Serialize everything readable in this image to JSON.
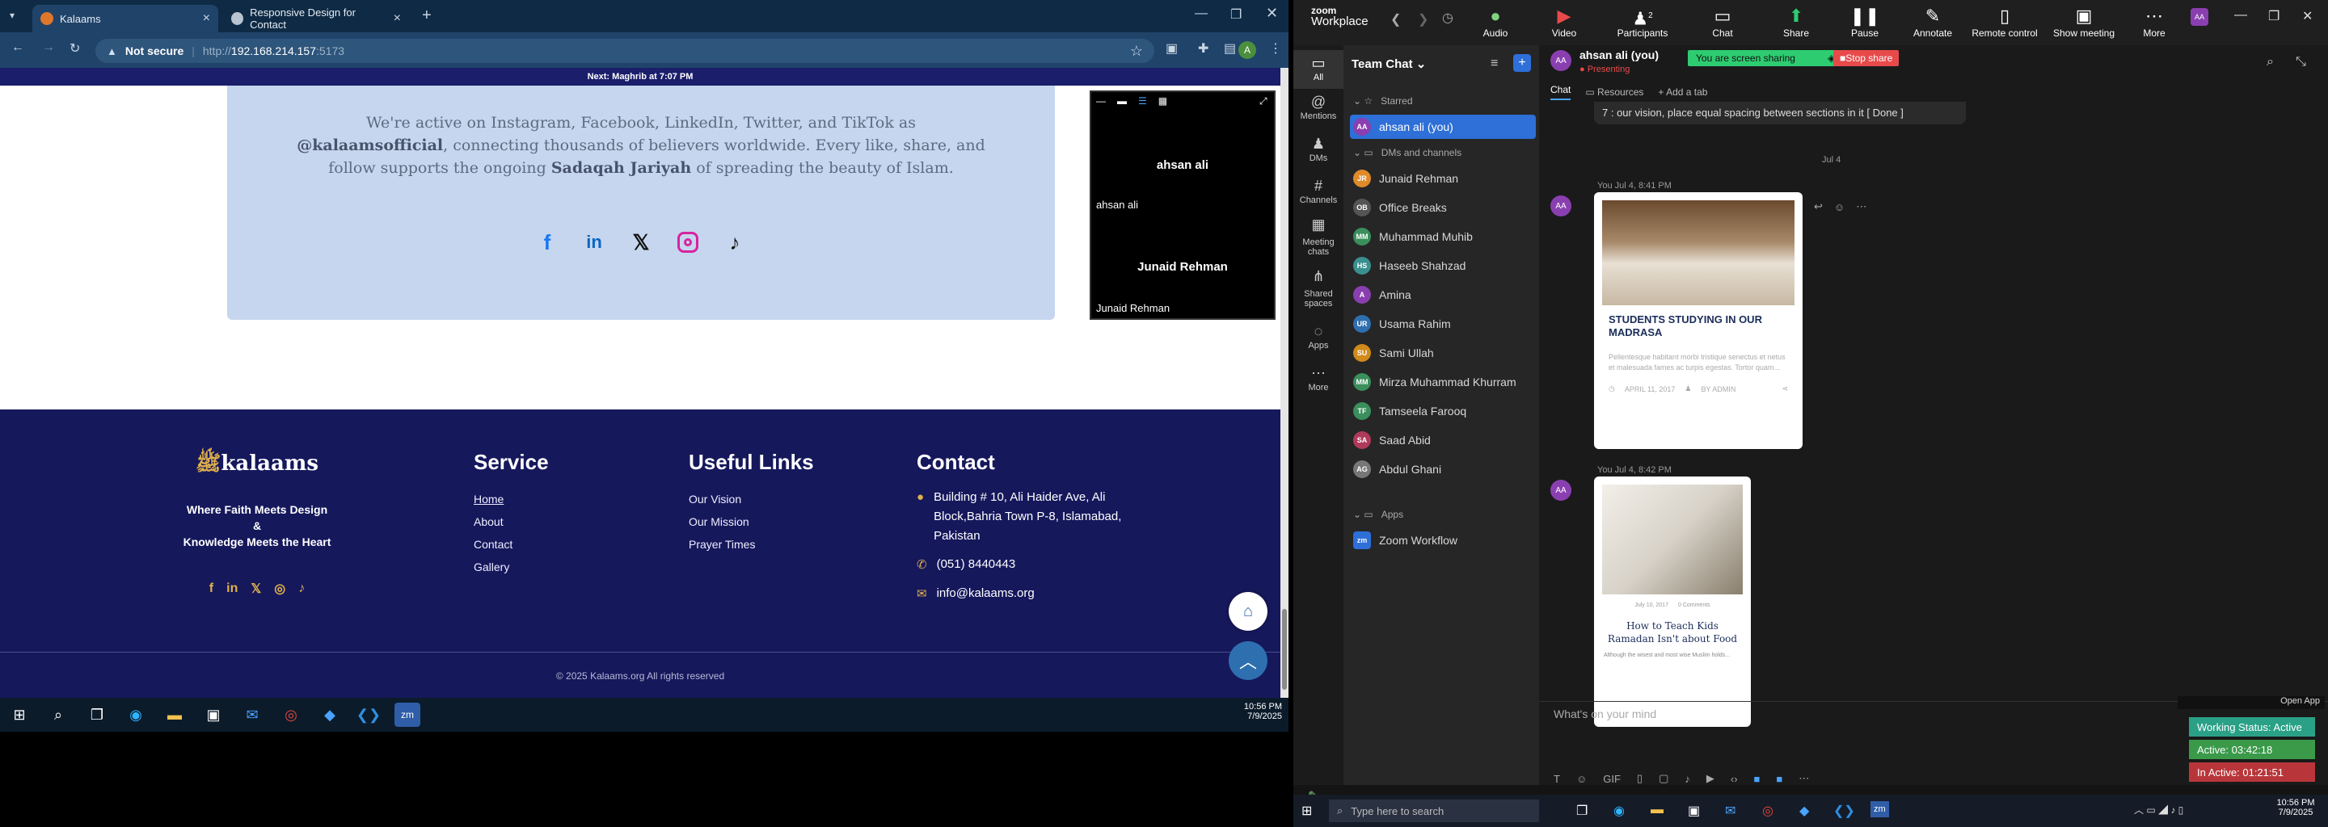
{
  "browser": {
    "tabs": [
      {
        "label": "Kalaams",
        "active": true
      },
      {
        "label": "Responsive Design for Contact",
        "active": false
      }
    ],
    "security": "Not secure",
    "url_prefix": "http://",
    "url_host": "192.168.214.157",
    "url_port": ":5173",
    "profile_initial": "A"
  },
  "website": {
    "prayer_bar": "Next: Maghrib at 7:07 PM",
    "social_text_1": "We're active on Instagram, Facebook, LinkedIn, Twitter, and TikTok as ",
    "social_handle": "@kalaamsofficial",
    "social_text_2": ", connecting thousands of believers worldwide. Every like, share, and follow supports the ongoing ",
    "social_bold": "Sadaqah Jariyah",
    "social_text_3": " of spreading the beauty of Islam.",
    "footer": {
      "logo": "kalaams",
      "tagline_1": "Where Faith Meets Design",
      "tagline_2": "&",
      "tagline_3": "Knowledge Meets the Heart",
      "service_title": "Service",
      "service_links": [
        "Home",
        "About",
        "Contact",
        "Gallery"
      ],
      "useful_title": "Useful Links",
      "useful_links": [
        "Our Vision",
        "Our Mission",
        "Prayer Times"
      ],
      "contact_title": "Contact",
      "address_1": "Building # 10, Ali Haider Ave, Ali",
      "address_2": "Block,Bahria Town P-8, Islamabad,",
      "address_3": "Pakistan",
      "phone": "(051) 8440443",
      "email": "info@kalaams.org",
      "copyright": "© 2025 Kalaams.org All rights reserved"
    }
  },
  "video_overlay": {
    "participant_1": "ahsan ali",
    "participant_1_label": "ahsan ali",
    "participant_2": "Junaid Rehman",
    "participant_2_label": "Junaid Rehman"
  },
  "left_taskbar": {
    "time": "10:56 PM",
    "date": "7/9/2025"
  },
  "zoom": {
    "brand_1": "zoom",
    "brand_2": "Workplace",
    "buttons": [
      "Audio",
      "Video",
      "Participants",
      "Chat",
      "Share",
      "Pause",
      "Annotate",
      "Remote control",
      "Show meeting",
      "More"
    ],
    "participant_count": "2",
    "sharing_banner": "You are screen sharing",
    "stop_share": "Stop share"
  },
  "teams": {
    "rail": [
      "All",
      "Mentions",
      "DMs",
      "Channels",
      "Meeting chats",
      "Shared spaces",
      "Apps",
      "More"
    ],
    "panel_title": "Team Chat",
    "starred_label": "Starred",
    "starred": [
      {
        "name": "ahsan ali (you)",
        "initials": "AA"
      }
    ],
    "dms_label": "DMs and channels",
    "dms": [
      {
        "name": "Junaid Rehman",
        "initials": "JR",
        "color": "#e08a2a"
      },
      {
        "name": "Office Breaks",
        "initials": "OB",
        "color": "#555555"
      },
      {
        "name": "Muhammad Muhib",
        "initials": "MM",
        "color": "#3a8f5c"
      },
      {
        "name": "Haseeb Shahzad",
        "initials": "HS",
        "color": "#3a8f8f"
      },
      {
        "name": "Amina",
        "initials": "A",
        "color": "#8a3fb0"
      },
      {
        "name": "Usama Rahim",
        "initials": "UR",
        "color": "#2e6fb0"
      },
      {
        "name": "Sami Ullah",
        "initials": "SU",
        "color": "#d08a1a"
      },
      {
        "name": "Mirza Muhammad Khurram",
        "initials": "MM",
        "color": "#3a8f5c"
      },
      {
        "name": "Tamseela Farooq",
        "initials": "TF",
        "color": "#3a8f5c"
      },
      {
        "name": "Saad Abid",
        "initials": "SA",
        "color": "#b03a5a"
      },
      {
        "name": "Abdul Ghani",
        "initials": "AG",
        "color": "#777777"
      }
    ],
    "apps_label": "Apps",
    "apps": [
      "Zoom Workflow"
    ],
    "chat_user": "ahsan ali (you)",
    "chat_status": "Presenting",
    "chat_tab": "Chat",
    "resources_tab": "Resources",
    "add_tab": "Add a tab",
    "prev_message": "7 : our vision, place equal spacing between sections in it  [ Done ]",
    "date_divider": "Jul 4",
    "msg1_meta": "You Jul 4, 8:41 PM",
    "msg1_title": "STUDENTS STUDYING IN OUR MADRASA",
    "msg1_body": "Pellentesque habitant morbi tristique senectus et netus et malesuada fames ac turpis egestas. Tortor quam...",
    "msg1_date": "APRIL 11, 2017",
    "msg1_author": "BY ADMIN",
    "msg2_meta": "You Jul 4, 8:42 PM",
    "msg2_date": "July 10, 2017",
    "msg2_comments": "0 Comments",
    "msg2_title": "How to Teach Kids Ramadan Isn't about Food",
    "msg2_body": "Although the wisest and most wise Muslim holds...",
    "compose_placeholder": "What's on your mind",
    "open_app": "Open App",
    "working_status": "Working Status: Active",
    "active_time": "Active: 03:42:18",
    "inactive_time": "In Active: 01:21:51"
  },
  "right_taskbar": {
    "search_placeholder": "Type here to search",
    "time": "10:56 PM",
    "date": "7/9/2025"
  }
}
